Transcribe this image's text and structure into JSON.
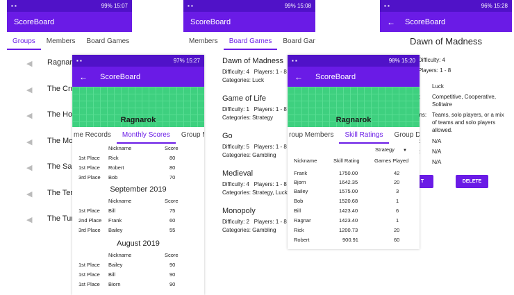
{
  "app_title": "ScoreBoard",
  "screen1": {
    "status_time": "15:07",
    "battery": "99%",
    "tabs": [
      "Groups",
      "Members",
      "Board Games"
    ],
    "groups": [
      "Ragnarok",
      "The Crusa",
      "The Hosp",
      "The Monc",
      "The Sarac",
      "The Temp",
      "The Turks"
    ]
  },
  "screen2": {
    "status_time": "15:08",
    "battery": "99%",
    "tabs": [
      "Members",
      "Board Games",
      "Board Game Ca"
    ],
    "games": [
      {
        "name": "Dawn of Madness",
        "difficulty": "4",
        "players": "1 - 8",
        "categories": "Luck"
      },
      {
        "name": "Game of Life",
        "difficulty": "1",
        "players": "1 - 8",
        "categories": "Strategy"
      },
      {
        "name": "Go",
        "difficulty": "5",
        "players": "1 - 8",
        "categories": "Gambling"
      },
      {
        "name": "Medieval",
        "difficulty": "4",
        "players": "1 - 8",
        "categories": "Strategy, Luck"
      },
      {
        "name": "Monopoly",
        "difficulty": "2",
        "players": "1 - 8",
        "categories": "Gambling"
      }
    ],
    "labels": {
      "difficulty": "Difficulty:",
      "players": "Players:",
      "categories": "Categories:"
    }
  },
  "screen3": {
    "status_time": "15:28",
    "battery": "96%",
    "title": "Dawn of Madness",
    "rows": [
      {
        "label": "Difficulty:",
        "value": "4"
      },
      {
        "label": "Players:",
        "value": "1 - 8"
      },
      {
        "label": "",
        "value": "Luck"
      },
      {
        "label": "s:",
        "value": "Competitive, Cooperative, Solitaire"
      },
      {
        "label": "ons:",
        "value": "Teams, solo players, or a mix of teams and solo players allowed."
      },
      {
        "label": "n:",
        "value": "N/A"
      },
      {
        "label": "s:",
        "value": "N/A"
      },
      {
        "label": "",
        "value": "N/A"
      }
    ],
    "edit_label": "T",
    "delete_label": "DELETE"
  },
  "overlay1": {
    "status_time": "15:27",
    "battery": "97%",
    "banner_title": "Ragnarok",
    "tabs": [
      "me Records",
      "Monthly Scores",
      "Group Memb"
    ],
    "months": [
      {
        "title": "",
        "header": [
          "Nickname",
          "Score"
        ],
        "rows": [
          [
            "1st Place",
            "Rick",
            "80"
          ],
          [
            "1st Place",
            "Robert",
            "80"
          ],
          [
            "3rd Place",
            "Bob",
            "70"
          ]
        ]
      },
      {
        "title": "September 2019",
        "header": [
          "Nickname",
          "Score"
        ],
        "rows": [
          [
            "1st Place",
            "Bill",
            "75"
          ],
          [
            "2nd Place",
            "Frank",
            "60"
          ],
          [
            "3rd Place",
            "Bailey",
            "55"
          ]
        ]
      },
      {
        "title": "August 2019",
        "header": [
          "Nickname",
          "Score"
        ],
        "rows": [
          [
            "1st Place",
            "Bailey",
            "90"
          ],
          [
            "1st Place",
            "Bill",
            "90"
          ],
          [
            "1st Place",
            "Biorn",
            "90"
          ]
        ]
      }
    ]
  },
  "overlay2": {
    "status_time": "15:20",
    "battery": "98%",
    "banner_title": "Ragnarok",
    "tabs": [
      "roup Members",
      "Skill Ratings",
      "Group Details"
    ],
    "filter": "Strategy",
    "header": [
      "Nickname",
      "Skill Rating",
      "Games Played"
    ],
    "rows": [
      [
        "Frank",
        "1750.00",
        "42"
      ],
      [
        "Bjorn",
        "1642.35",
        "20"
      ],
      [
        "Bailey",
        "1575.00",
        "3"
      ],
      [
        "Bob",
        "1520.68",
        "1"
      ],
      [
        "Bill",
        "1423.40",
        "6"
      ],
      [
        "Ragnar",
        "1423.40",
        "1"
      ],
      [
        "Rick",
        "1200.73",
        "20"
      ],
      [
        "Robert",
        "900.91",
        "60"
      ]
    ]
  }
}
